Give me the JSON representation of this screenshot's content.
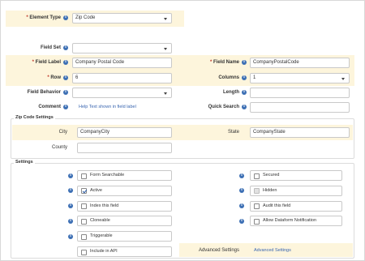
{
  "element_type": {
    "label": "Element Type",
    "required_mark": "*",
    "value": "Zip Code"
  },
  "field_set": {
    "label": "Field Set",
    "value": ""
  },
  "field_label": {
    "label": "Field Label",
    "required_mark": "*",
    "value": "Company Postal Code"
  },
  "field_name": {
    "label": "Field Name",
    "required_mark": "*",
    "value": "CompanyPostalCode"
  },
  "row": {
    "label": "Row",
    "required_mark": "*",
    "value": "6"
  },
  "columns": {
    "label": "Columns",
    "value": "1"
  },
  "field_behavior": {
    "label": "Field Behavior",
    "value": ""
  },
  "length": {
    "label": "Length",
    "value": ""
  },
  "comment": {
    "label": "Comment",
    "value": "Help Text shown in field label"
  },
  "quick_search": {
    "label": "Quick Search",
    "value": ""
  },
  "zip_settings": {
    "legend": "Zip Code Settings",
    "city_label": "City",
    "city_value": "CompanyCity",
    "state_label": "State",
    "state_value": "CompanyState",
    "county_label": "County",
    "county_value": ""
  },
  "settings": {
    "legend": "Settings",
    "left": [
      {
        "label": "Form Searchable",
        "checked": false,
        "disabled": false,
        "info": true
      },
      {
        "label": "Active",
        "checked": true,
        "disabled": false,
        "info": true
      },
      {
        "label": "Index this field",
        "checked": false,
        "disabled": false,
        "info": true
      },
      {
        "label": "Cloneable",
        "checked": false,
        "disabled": false,
        "info": true
      },
      {
        "label": "Triggerable",
        "checked": false,
        "disabled": false,
        "info": true
      },
      {
        "label": "Include in API",
        "checked": false,
        "disabled": false,
        "info": false
      }
    ],
    "right": [
      {
        "label": "Secured",
        "checked": false,
        "disabled": false
      },
      {
        "label": "Hidden",
        "checked": false,
        "disabled": true
      },
      {
        "label": "Audit this field",
        "checked": false,
        "disabled": false
      },
      {
        "label": "Allow Dataform Notification",
        "checked": false,
        "disabled": false
      }
    ],
    "advanced_label": "Advanced Settings",
    "advanced_link": "Advanced Settings"
  },
  "icons": {
    "info": "info-icon",
    "dropdown": "chevron-down-icon",
    "checkbox": "checkbox-icon"
  },
  "colors": {
    "highlight": "#fdf5dc",
    "required": "#c0392b",
    "info": "#3c6fb4",
    "link": "#3a66b0"
  }
}
